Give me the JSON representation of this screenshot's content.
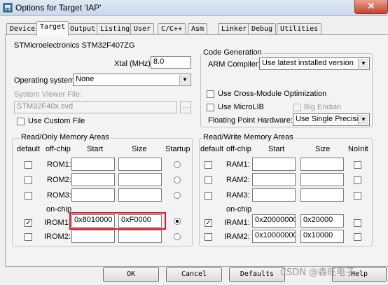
{
  "window": {
    "title": "Options for Target 'IAP'",
    "close_glyph": "✕"
  },
  "tabs": [
    {
      "label": "Device"
    },
    {
      "label": "Target"
    },
    {
      "label": "Output"
    },
    {
      "label": "Listing"
    },
    {
      "label": "User"
    },
    {
      "label": "C/C++"
    },
    {
      "label": "Asm"
    },
    {
      "label": "Linker"
    },
    {
      "label": "Debug"
    },
    {
      "label": "Utilities"
    }
  ],
  "target": {
    "device": "STMicroelectronics STM32F407ZG",
    "xtal_label": "Xtal (MHz):",
    "xtal_value": "8.0",
    "os_label": "Operating system:",
    "os_value": "None",
    "svd_label": "System Viewer File:",
    "svd_value": "STM32F40x.svd",
    "browse": "...",
    "custom_file_label": "Use Custom File"
  },
  "codegen": {
    "title": "Code Generation",
    "compiler_label": "ARM Compiler:",
    "compiler_value": "Use latest installed version",
    "cross_module_label": "Use Cross-Module Optimization",
    "microlib_label": "Use MicroLIB",
    "big_endian_label": "Big Endian",
    "fpu_label": "Floating Point Hardware:",
    "fpu_value": "Use Single Precision"
  },
  "rom": {
    "title": "Read/Only Memory Areas",
    "headers": {
      "default": "default",
      "offchip": "off-chip",
      "start": "Start",
      "size": "Size",
      "startup": "Startup"
    },
    "onchip_label": "on-chip",
    "rows": [
      {
        "name": "ROM1:",
        "start": "",
        "size": "",
        "default": false,
        "startup": false
      },
      {
        "name": "ROM2:",
        "start": "",
        "size": "",
        "default": false,
        "startup": false
      },
      {
        "name": "ROM3:",
        "start": "",
        "size": "",
        "default": false,
        "startup": false
      },
      {
        "name": "IROM1:",
        "start": "0x8010000",
        "size": "0xF0000",
        "default": true,
        "startup": true
      },
      {
        "name": "IROM2:",
        "start": "",
        "size": "",
        "default": false,
        "startup": false
      }
    ]
  },
  "ram": {
    "title": "Read/Write Memory Areas",
    "headers": {
      "default": "default",
      "offchip": "off-chip",
      "start": "Start",
      "size": "Size",
      "noinit": "NoInit"
    },
    "onchip_label": "on-chip",
    "rows": [
      {
        "name": "RAM1:",
        "start": "",
        "size": "",
        "default": false
      },
      {
        "name": "RAM2:",
        "start": "",
        "size": "",
        "default": false
      },
      {
        "name": "RAM3:",
        "start": "",
        "size": "",
        "default": false
      },
      {
        "name": "IRAM1:",
        "start": "0x20000000",
        "size": "0x20000",
        "default": true
      },
      {
        "name": "IRAM2:",
        "start": "0x10000000",
        "size": "0x10000",
        "default": false
      }
    ]
  },
  "buttons": {
    "ok": "OK",
    "cancel": "Cancel",
    "defaults": "Defaults",
    "help": "Help"
  },
  "watermark": "CSDN @森旺电子",
  "colors": {
    "highlight": "#e0142a",
    "titlebar": "#c9d8ec"
  }
}
